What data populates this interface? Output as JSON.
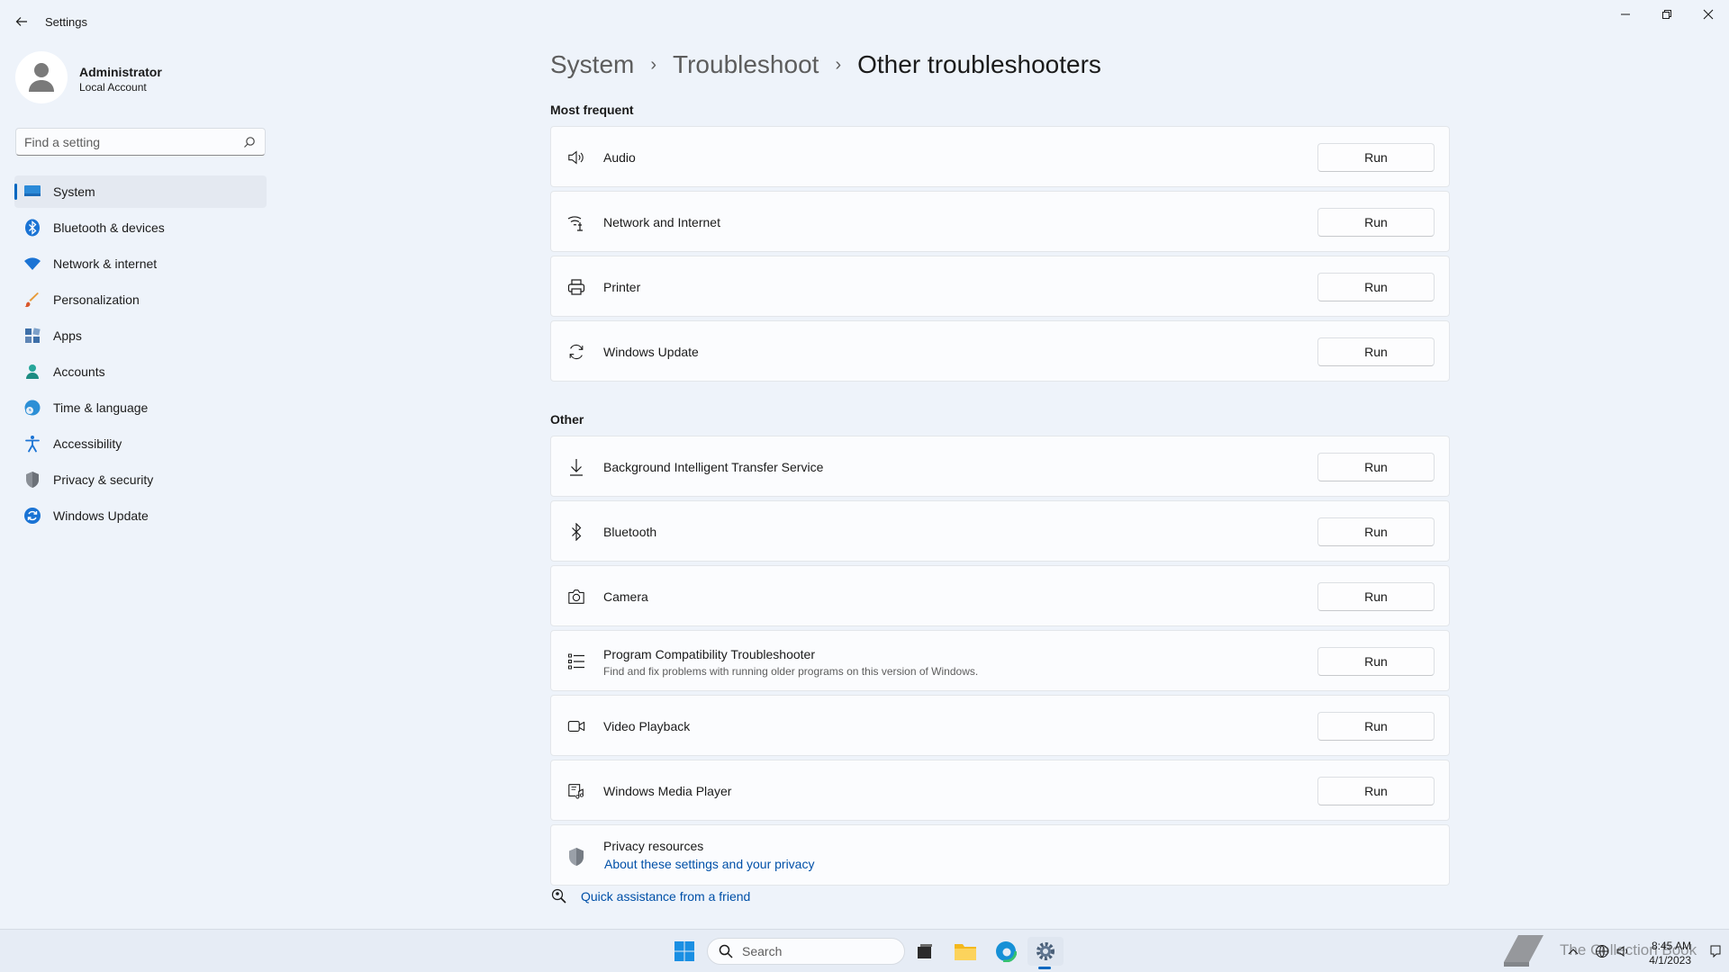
{
  "window": {
    "title": "Settings"
  },
  "profile": {
    "name": "Administrator",
    "account_type": "Local Account"
  },
  "search": {
    "placeholder": "Find a setting"
  },
  "sidebar": {
    "items": [
      {
        "label": "System",
        "icon": "monitor-icon",
        "active": true
      },
      {
        "label": "Bluetooth & devices",
        "icon": "bluetooth-icon"
      },
      {
        "label": "Network & internet",
        "icon": "wifi-icon"
      },
      {
        "label": "Personalization",
        "icon": "brush-icon"
      },
      {
        "label": "Apps",
        "icon": "apps-icon"
      },
      {
        "label": "Accounts",
        "icon": "person-icon"
      },
      {
        "label": "Time & language",
        "icon": "globe-clock-icon"
      },
      {
        "label": "Accessibility",
        "icon": "accessibility-icon"
      },
      {
        "label": "Privacy & security",
        "icon": "shield-icon"
      },
      {
        "label": "Windows Update",
        "icon": "update-icon"
      }
    ]
  },
  "breadcrumb": {
    "items": [
      "System",
      "Troubleshoot"
    ],
    "current": "Other troubleshooters",
    "separator": "›"
  },
  "sections": {
    "most_frequent": {
      "title": "Most frequent",
      "items": [
        {
          "label": "Audio",
          "icon": "speaker-icon"
        },
        {
          "label": "Network and Internet",
          "icon": "network-icon"
        },
        {
          "label": "Printer",
          "icon": "printer-icon"
        },
        {
          "label": "Windows Update",
          "icon": "sync-icon"
        }
      ]
    },
    "other": {
      "title": "Other",
      "items": [
        {
          "label": "Background Intelligent Transfer Service",
          "icon": "download-icon"
        },
        {
          "label": "Bluetooth",
          "icon": "bluetooth-icon"
        },
        {
          "label": "Camera",
          "icon": "camera-icon"
        },
        {
          "label": "Program Compatibility Troubleshooter",
          "description": "Find and fix problems with running older programs on this version of Windows.",
          "icon": "list-icon"
        },
        {
          "label": "Video Playback",
          "icon": "video-icon"
        },
        {
          "label": "Windows Media Player",
          "icon": "media-player-icon"
        }
      ]
    }
  },
  "run_label": "Run",
  "privacy": {
    "title": "Privacy resources",
    "link": "About these settings and your privacy"
  },
  "quick_assist": {
    "label": "Quick assistance from a friend"
  },
  "taskbar": {
    "search_label": "Search",
    "time": "8:45 AM",
    "date": "4/1/2023"
  },
  "watermark": {
    "text": "The Collection Book"
  },
  "colors": {
    "accent": "#0067c0",
    "link": "#0050a8",
    "background": "#eef3fa",
    "card": "#fbfcfe"
  }
}
